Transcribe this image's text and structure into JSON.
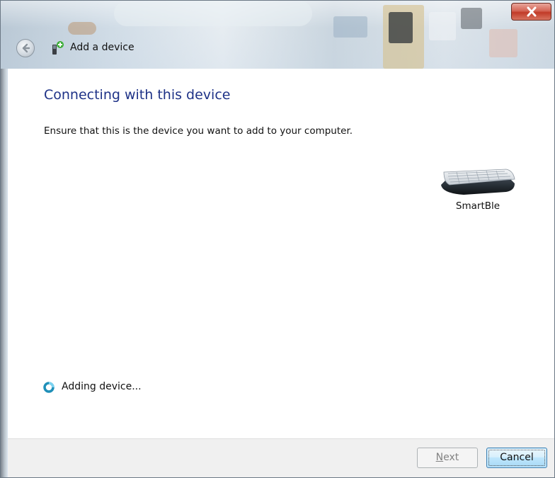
{
  "window": {
    "title": "Add a device"
  },
  "main": {
    "heading": "Connecting with this device",
    "instruction": "Ensure that this is the device you want to add to your computer."
  },
  "device": {
    "name": "SmartBle",
    "icon": "keyboard-icon"
  },
  "status": {
    "text": "Adding device...",
    "icon": "busy-spinner-icon"
  },
  "footer": {
    "next_label_mnemonic": "N",
    "next_label_rest": "ext",
    "cancel_label": "Cancel"
  },
  "colors": {
    "heading": "#1e3287",
    "close_button": "#c13b28",
    "footer_bg": "#f0f0f0",
    "accent_button": "#a7d9f5"
  }
}
